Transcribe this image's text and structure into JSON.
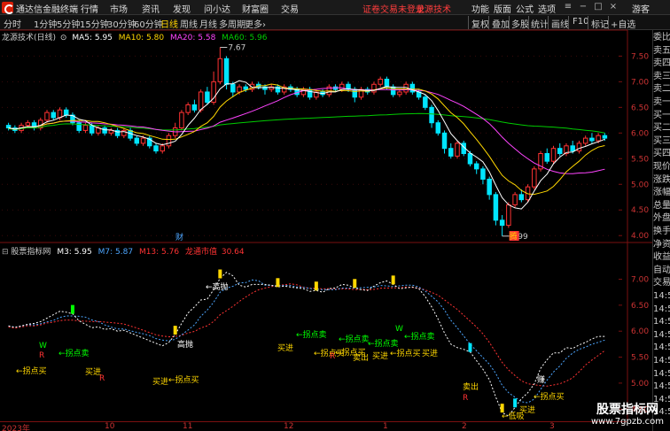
{
  "menubar": {
    "app_title": "通达信金融终端",
    "items": [
      "行情",
      "市场",
      "资讯",
      "发现",
      "问小达",
      "财富圈",
      "交易"
    ],
    "login_status": "证卷交易未登录",
    "plugin": "龙源技术",
    "right_items": [
      "功能",
      "版面",
      "公式",
      "选项"
    ],
    "guest": "游客"
  },
  "toolbar": {
    "periods": [
      "分时",
      "1分钟",
      "5分钟",
      "15分钟",
      "30分钟",
      "60分钟",
      "日线",
      "周线",
      "月线",
      "多周期",
      "更多"
    ],
    "active_period": "日线",
    "more_caret": "›",
    "tools": [
      "复权",
      "叠加",
      "多股",
      "统计",
      "画线",
      "F10",
      "标记",
      "+自选"
    ]
  },
  "main_chart": {
    "legend": {
      "title": "龙源技术(日线)",
      "ma5": "MA5: 5.95",
      "ma10": "MA10: 5.80",
      "ma20": "MA20: 5.58",
      "ma60": "MA60: 5.96"
    },
    "annotations": {
      "high": "7.67",
      "low": "3.99",
      "tag_cai": "财",
      "tag_qian": "腾"
    },
    "colors": {
      "up": "#ff3333",
      "down": "#00e5ff",
      "ma5": "#ffffff",
      "ma10": "#ffd700",
      "ma20": "#ff44ff",
      "ma60": "#00cc00"
    }
  },
  "sub_chart": {
    "legend": {
      "title": "股票指标网",
      "m3": "M3: 5.95",
      "m7": "M7: 5.87",
      "m13": "M13: 5.76",
      "channel_label": "龙通市值",
      "channel_value": "30.64"
    },
    "labels": {
      "high_throw": "←高抛",
      "turn_buy": "←拐点买",
      "turn_sell": "←拐点卖",
      "buy_in": "买进",
      "sell_out": "卖出",
      "w": "W",
      "r": "R",
      "low_suck": "←低吸",
      "high_throw_short": "高抛",
      "gain": "赚"
    }
  },
  "chart_data": [
    {
      "type": "candlestick",
      "title": "龙源技术(日线)",
      "yaxis_ticks": [
        "7.50",
        "7.00",
        "6.50",
        "6.00",
        "5.50",
        "5.00",
        "4.50",
        "4.00"
      ],
      "ylim": [
        3.9,
        7.8
      ],
      "high_label": 7.67,
      "low_label": 3.99,
      "candles": [
        [
          6.15,
          6.1,
          6.2,
          6.05
        ],
        [
          6.1,
          6.05,
          6.15,
          6.0
        ],
        [
          6.05,
          6.15,
          6.2,
          6.0
        ],
        [
          6.15,
          6.2,
          6.25,
          6.1
        ],
        [
          6.2,
          6.1,
          6.25,
          6.05
        ],
        [
          6.1,
          6.25,
          6.3,
          6.05
        ],
        [
          6.25,
          6.4,
          6.45,
          6.2
        ],
        [
          6.4,
          6.3,
          6.45,
          6.25
        ],
        [
          6.3,
          6.45,
          6.5,
          6.25
        ],
        [
          6.45,
          6.35,
          6.5,
          6.3
        ],
        [
          6.35,
          6.2,
          6.4,
          6.15
        ],
        [
          6.2,
          6.05,
          6.25,
          6.0
        ],
        [
          6.05,
          6.15,
          6.2,
          6.0
        ],
        [
          6.15,
          6.0,
          6.2,
          5.95
        ],
        [
          6.0,
          6.1,
          6.15,
          5.95
        ],
        [
          6.1,
          6.0,
          6.15,
          5.95
        ],
        [
          6.0,
          6.05,
          6.1,
          5.95
        ],
        [
          6.05,
          5.95,
          6.1,
          5.9
        ],
        [
          5.95,
          6.05,
          6.1,
          5.9
        ],
        [
          6.05,
          5.9,
          6.1,
          5.85
        ],
        [
          5.9,
          5.8,
          5.95,
          5.75
        ],
        [
          5.8,
          5.9,
          5.95,
          5.75
        ],
        [
          5.9,
          5.75,
          5.95,
          5.7
        ],
        [
          5.75,
          5.65,
          5.8,
          5.6
        ],
        [
          5.65,
          5.75,
          5.8,
          5.6
        ],
        [
          5.75,
          5.95,
          6.0,
          5.7
        ],
        [
          5.95,
          6.1,
          6.2,
          5.9
        ],
        [
          6.1,
          6.4,
          6.45,
          6.05
        ],
        [
          6.4,
          6.55,
          6.6,
          6.35
        ],
        [
          6.55,
          6.45,
          6.65,
          6.4
        ],
        [
          6.45,
          6.8,
          6.85,
          6.4
        ],
        [
          6.8,
          6.6,
          6.9,
          6.55
        ],
        [
          6.6,
          7.0,
          7.2,
          6.55
        ],
        [
          7.0,
          7.45,
          7.67,
          6.95
        ],
        [
          7.45,
          6.95,
          7.5,
          6.85
        ],
        [
          6.95,
          6.8,
          7.0,
          6.7
        ],
        [
          6.8,
          6.9,
          6.95,
          6.75
        ],
        [
          6.9,
          6.85,
          6.95,
          6.8
        ],
        [
          6.85,
          6.95,
          7.0,
          6.8
        ],
        [
          6.95,
          6.9,
          7.0,
          6.85
        ],
        [
          6.9,
          6.85,
          6.95,
          6.75
        ],
        [
          6.85,
          6.9,
          6.95,
          6.8
        ],
        [
          6.9,
          6.8,
          6.95,
          6.75
        ],
        [
          6.8,
          6.9,
          6.95,
          6.75
        ],
        [
          6.9,
          6.85,
          6.95,
          6.8
        ],
        [
          6.85,
          6.75,
          6.9,
          6.7
        ],
        [
          6.75,
          6.85,
          6.9,
          6.7
        ],
        [
          6.85,
          6.7,
          6.9,
          6.65
        ],
        [
          6.7,
          6.8,
          6.85,
          6.65
        ],
        [
          6.8,
          6.75,
          6.85,
          6.7
        ],
        [
          6.75,
          6.9,
          6.95,
          6.7
        ],
        [
          6.9,
          6.85,
          6.95,
          6.8
        ],
        [
          6.85,
          6.95,
          7.0,
          6.8
        ],
        [
          6.95,
          6.85,
          7.0,
          6.8
        ],
        [
          6.85,
          6.7,
          6.9,
          6.6
        ],
        [
          6.7,
          6.85,
          6.9,
          6.65
        ],
        [
          6.85,
          6.8,
          6.9,
          6.75
        ],
        [
          6.8,
          6.95,
          7.0,
          6.75
        ],
        [
          6.95,
          7.05,
          7.1,
          6.9
        ],
        [
          7.05,
          6.9,
          7.1,
          6.85
        ],
        [
          6.9,
          6.75,
          6.95,
          6.7
        ],
        [
          6.75,
          6.8,
          6.85,
          6.7
        ],
        [
          6.8,
          6.95,
          7.0,
          6.75
        ],
        [
          6.95,
          6.8,
          7.0,
          6.75
        ],
        [
          6.8,
          6.7,
          6.85,
          6.65
        ],
        [
          6.7,
          6.5,
          6.75,
          6.45
        ],
        [
          6.5,
          6.2,
          6.55,
          6.1
        ],
        [
          6.2,
          6.0,
          6.25,
          5.95
        ],
        [
          6.0,
          5.7,
          6.05,
          5.6
        ],
        [
          5.7,
          5.55,
          5.8,
          5.5
        ],
        [
          5.55,
          5.8,
          5.85,
          5.5
        ],
        [
          5.8,
          5.6,
          5.85,
          5.55
        ],
        [
          5.6,
          5.4,
          5.65,
          5.35
        ],
        [
          5.4,
          5.3,
          5.45,
          5.2
        ],
        [
          5.3,
          5.1,
          5.35,
          5.0
        ],
        [
          5.1,
          4.8,
          5.15,
          4.7
        ],
        [
          4.8,
          4.3,
          4.85,
          4.2
        ],
        [
          4.3,
          4.2,
          4.4,
          3.99
        ],
        [
          4.2,
          4.6,
          4.65,
          4.15
        ],
        [
          4.6,
          4.8,
          4.85,
          4.55
        ],
        [
          4.8,
          4.7,
          4.9,
          4.65
        ],
        [
          4.7,
          4.95,
          5.0,
          4.65
        ],
        [
          4.95,
          5.3,
          5.35,
          4.9
        ],
        [
          5.3,
          5.6,
          5.65,
          5.25
        ],
        [
          5.6,
          5.45,
          5.7,
          5.4
        ],
        [
          5.45,
          5.7,
          5.75,
          5.4
        ],
        [
          5.7,
          5.6,
          5.8,
          5.55
        ],
        [
          5.6,
          5.75,
          5.8,
          5.55
        ],
        [
          5.75,
          5.65,
          5.85,
          5.6
        ],
        [
          5.65,
          5.8,
          5.85,
          5.6
        ],
        [
          5.8,
          5.9,
          5.95,
          5.75
        ],
        [
          5.9,
          5.85,
          6.0,
          5.8
        ],
        [
          5.85,
          5.95,
          6.0,
          5.8
        ],
        [
          5.95,
          5.9,
          6.0,
          5.85
        ]
      ]
    },
    {
      "type": "line",
      "title": "股票指标网",
      "yaxis_ticks": [
        "7.00",
        "6.50",
        "6.00",
        "5.50",
        "5.00",
        "4.50"
      ],
      "series": [
        {
          "name": "M3",
          "color": "#ffffff",
          "last": 5.95
        },
        {
          "name": "M7",
          "color": "#4da6ff",
          "last": 5.87
        },
        {
          "name": "M13",
          "color": "#ff3333",
          "last": 5.76
        }
      ]
    }
  ],
  "right_panel": {
    "items": [
      "委比",
      "卖五",
      "卖四",
      "卖三",
      "卖二",
      "卖一",
      "买一",
      "买二",
      "买三",
      "买四",
      "现价",
      "涨跌",
      "涨幅",
      "总量",
      "外盘",
      "换手",
      "净资",
      "收益",
      "自动",
      "交易",
      "14:55",
      "14:55",
      "14:55",
      "14:55",
      "14:55",
      "14:55",
      "14:55",
      "14:55",
      "14:55",
      "14:55"
    ]
  },
  "date_axis": {
    "ticks": [
      "2023年",
      "10",
      "11",
      "12",
      "1",
      "2",
      "3"
    ]
  },
  "watermark": {
    "big": "股票指标网",
    "url": "www.7gpzb.com"
  }
}
